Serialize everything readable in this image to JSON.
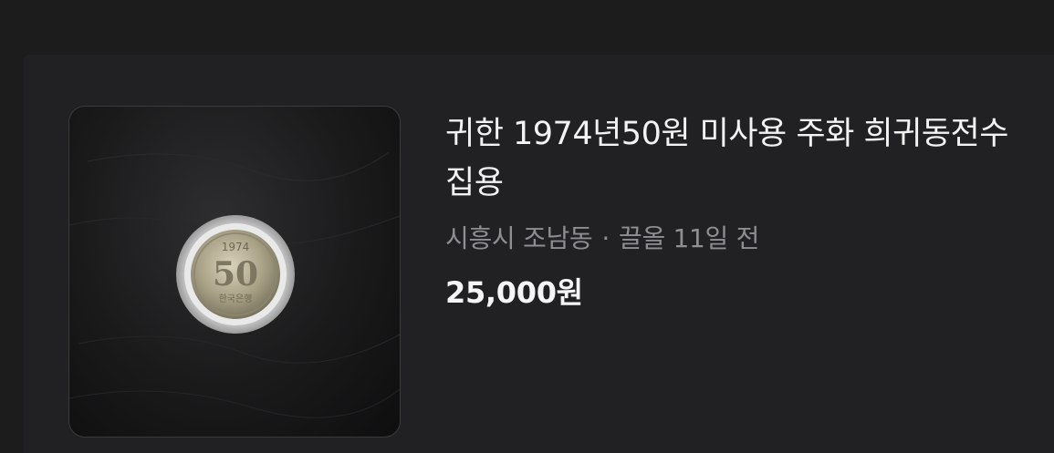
{
  "listing": {
    "title": "귀한 1974년50원 미사용 주화 희귀동전수집용",
    "location": "시흥시 조남동",
    "separator": "·",
    "time": "끌올 11일 전",
    "price": "25,000원",
    "image": {
      "subject": "coin-in-capsule",
      "coin_year": "1974",
      "coin_value": "50",
      "coin_inscription": "한국은행"
    }
  },
  "colors": {
    "page_background": "#1c1c1d",
    "card_background": "#212123",
    "title_text": "#f2f2f2",
    "meta_text": "#8e8e93",
    "price_text": "#f5f5f5"
  }
}
